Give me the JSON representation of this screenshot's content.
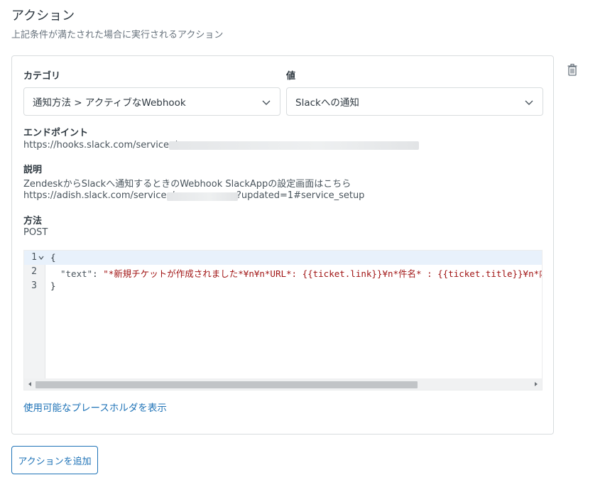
{
  "section": {
    "title": "アクション",
    "subtitle": "上記条件が満たされた場合に実行されるアクション"
  },
  "action": {
    "category_label": "カテゴリ",
    "category_value": "通知方法 > アクティブなWebhook",
    "value_label": "値",
    "value_value": "Slackへの通知",
    "endpoint_label": "エンドポイント",
    "endpoint_url": "https://hooks.slack.com/services/",
    "description_label": "説明",
    "description_line1": "ZendeskからSlackへ通知するときのWebhook SlackAppの設定画面はこちら",
    "description_url_prefix": "https://adish.slack.com/services/",
    "description_url_suffix": "?updated=1#service_setup",
    "method_label": "方法",
    "method_value": "POST",
    "delete_icon": "trash-icon"
  },
  "editor": {
    "line_numbers": [
      "1",
      "2",
      "3"
    ],
    "lines": [
      {
        "text": "{"
      },
      {
        "key": "\"text\"",
        "sep": ": ",
        "value": "\"*新規チケットが作成されました*¥n¥n*URL*: {{ticket.link}}¥n*件名* : {{ticket.title}}¥n*内容"
      },
      {
        "text": "}"
      }
    ]
  },
  "placeholder_link": "使用可能なプレースホルダを表示",
  "add_action_button": "アクションを追加",
  "colors": {
    "accent": "#1f73b7",
    "string": "#a11515",
    "border": "#d8dcde"
  }
}
